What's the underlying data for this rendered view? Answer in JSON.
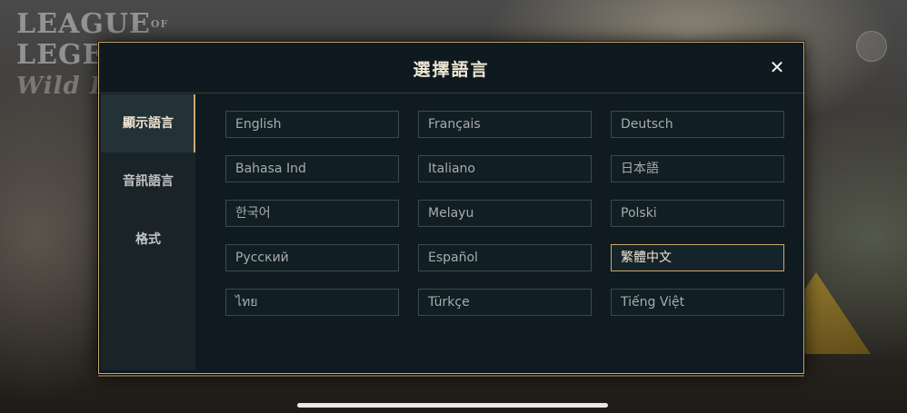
{
  "background": {
    "logo": {
      "line1": "LEAGUE",
      "of": "OF",
      "line2": "LEGENDS",
      "line3": "Wild Rift"
    }
  },
  "dialog": {
    "title": "選擇語言",
    "close_icon": "✕",
    "sidebar": {
      "items": [
        {
          "label": "顯示語言",
          "active": true
        },
        {
          "label": "音訊語言",
          "active": false
        },
        {
          "label": "格式",
          "active": false
        }
      ]
    },
    "languages": [
      {
        "label": "English"
      },
      {
        "label": "Français"
      },
      {
        "label": "Deutsch"
      },
      {
        "label": "Bahasa Ind"
      },
      {
        "label": "Italiano"
      },
      {
        "label": "日本語"
      },
      {
        "label": "한국어"
      },
      {
        "label": "Melayu"
      },
      {
        "label": "Polski"
      },
      {
        "label": "Русский"
      },
      {
        "label": "Español"
      },
      {
        "label": "繁體中文",
        "selected": true
      },
      {
        "label": "ไทย"
      },
      {
        "label": "Türkçe"
      },
      {
        "label": "Tiếng Việt"
      }
    ]
  },
  "colors": {
    "accent_gold": "#c8aa6e",
    "panel_bg": "#0e1a1f",
    "text_light": "#f0e6d2",
    "text_muted": "#a8acab"
  }
}
